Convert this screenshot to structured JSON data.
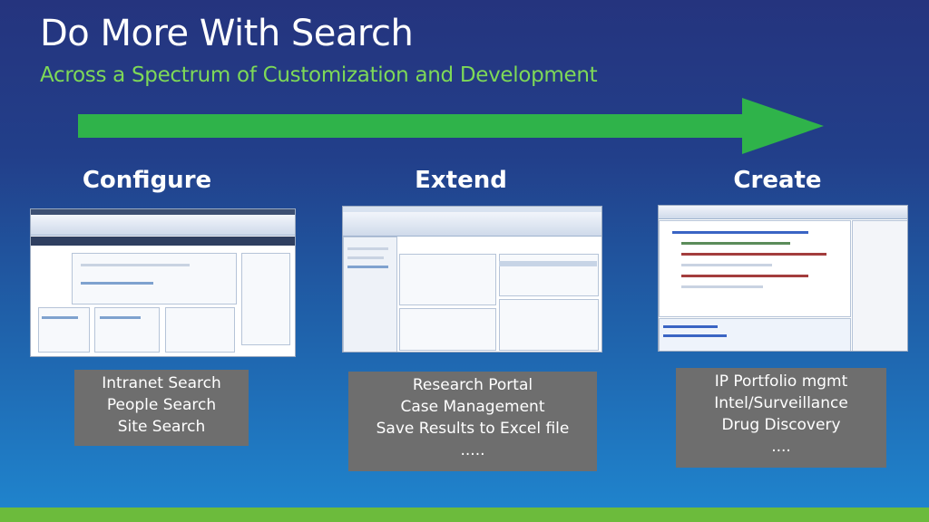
{
  "slide": {
    "title": "Do More With Search",
    "subtitle": "Across a Spectrum of Customization and Development",
    "colors": {
      "title": "#ffffff",
      "subtitle": "#7ed957",
      "arrow": "#2fb34a",
      "caption_bg": "#6e6e6e",
      "bottom_bar": "#6cbb3c"
    }
  },
  "columns": [
    {
      "heading": "Configure",
      "items": [
        "Intranet Search",
        "People Search",
        "Site Search"
      ]
    },
    {
      "heading": "Extend",
      "items": [
        "Research Portal",
        "Case Management",
        "Save Results to Excel file",
        "....."
      ]
    },
    {
      "heading": "Create",
      "items": [
        "IP Portfolio mgmt",
        "Intel/Surveillance",
        "Drug Discovery",
        "...."
      ]
    }
  ]
}
